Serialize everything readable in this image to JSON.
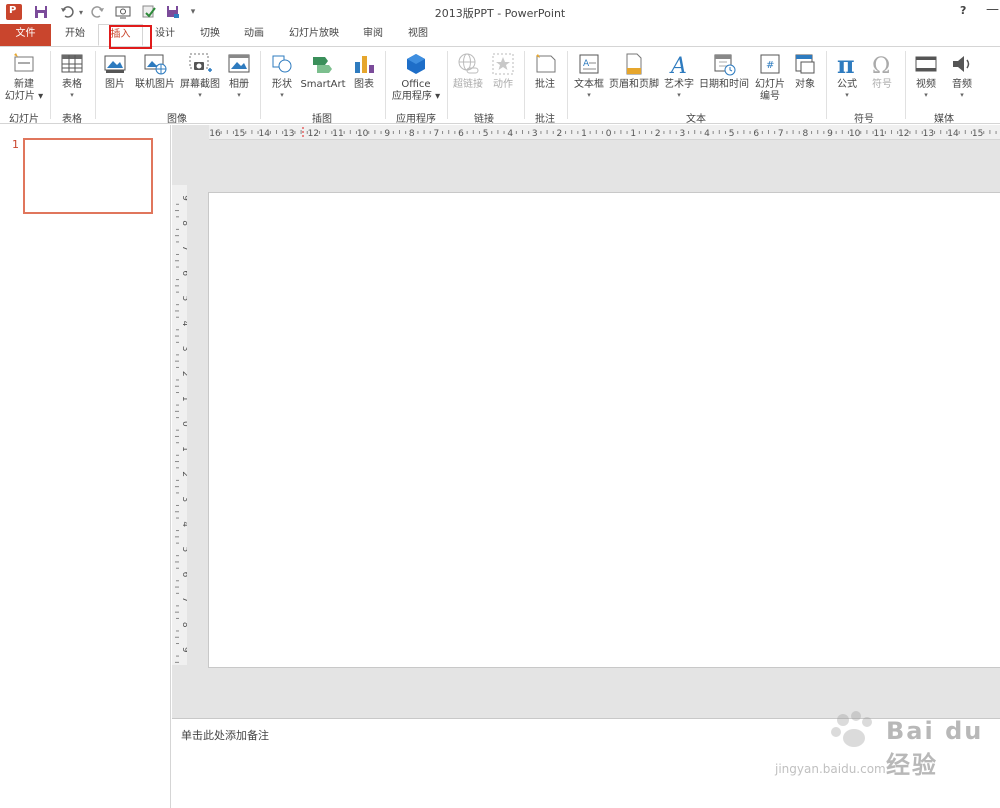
{
  "title_bar": {
    "title": "2013版PPT - PowerPoint",
    "help": "?",
    "minimize": "—",
    "quick_access": [
      "app-icon",
      "save-icon",
      "undo-icon",
      "redo-icon",
      "preview-icon",
      "spellcheck-icon",
      "save-as-icon",
      "customize-icon"
    ]
  },
  "app_icon_text": "P",
  "tabs": [
    "文件",
    "开始",
    "插入",
    "设计",
    "切换",
    "动画",
    "幻灯片放映",
    "审阅",
    "视图"
  ],
  "active_tab": "插入",
  "ribbon": {
    "groups": [
      {
        "label": "幻灯片",
        "buttons": [
          {
            "line1": "新建",
            "line2": "幻灯片 ▾"
          }
        ]
      },
      {
        "label": "表格",
        "buttons": [
          {
            "line1": "表格"
          }
        ]
      },
      {
        "label": "图像",
        "buttons": [
          {
            "line1": "图片"
          },
          {
            "line1": "联机图片"
          },
          {
            "line1": "屏幕截图"
          },
          {
            "line1": "相册"
          }
        ]
      },
      {
        "label": "插图",
        "buttons": [
          {
            "line1": "形状"
          },
          {
            "line1": "SmartArt"
          },
          {
            "line1": "图表"
          }
        ]
      },
      {
        "label": "应用程序",
        "buttons": [
          {
            "line1": "Office",
            "line2": "应用程序 ▾"
          }
        ]
      },
      {
        "label": "链接",
        "buttons": [
          {
            "line1": "超链接"
          },
          {
            "line1": "动作"
          }
        ]
      },
      {
        "label": "批注",
        "buttons": [
          {
            "line1": "批注"
          }
        ]
      },
      {
        "label": "文本",
        "buttons": [
          {
            "line1": "文本框"
          },
          {
            "line1": "页眉和页脚"
          },
          {
            "line1": "艺术字"
          },
          {
            "line1": "日期和时间"
          },
          {
            "line1": "幻灯片",
            "line2": "编号"
          },
          {
            "line1": "对象"
          }
        ]
      },
      {
        "label": "符号",
        "buttons": [
          {
            "line1": "公式"
          },
          {
            "line1": "符号"
          }
        ]
      },
      {
        "label": "媒体",
        "buttons": [
          {
            "line1": "视频"
          },
          {
            "line1": "音频"
          }
        ]
      }
    ]
  },
  "hruler_labels": [
    "16",
    "15",
    "14",
    "13",
    "12",
    "11",
    "10",
    "9",
    "8",
    "7",
    "6",
    "5",
    "4",
    "3",
    "2",
    "1",
    "0",
    "1",
    "2",
    "3",
    "4",
    "5",
    "6",
    "7",
    "8",
    "9",
    "10",
    "11",
    "12",
    "13",
    "14",
    "15",
    "16"
  ],
  "vruler_labels": [
    "9",
    "8",
    "7",
    "6",
    "5",
    "4",
    "3",
    "2",
    "1",
    "0",
    "1",
    "2",
    "3",
    "4",
    "5",
    "6",
    "7",
    "8",
    "9"
  ],
  "slides_panel": {
    "slide_number": "1"
  },
  "notes": {
    "placeholder": "单击此处添加备注"
  },
  "watermark": {
    "brand": "Bai du 经验",
    "url": "jingyan.baidu.com"
  },
  "colors": {
    "accent": "#c9452d",
    "highlight_box": "#e01b1b",
    "thumb_border": "#e0765c"
  }
}
